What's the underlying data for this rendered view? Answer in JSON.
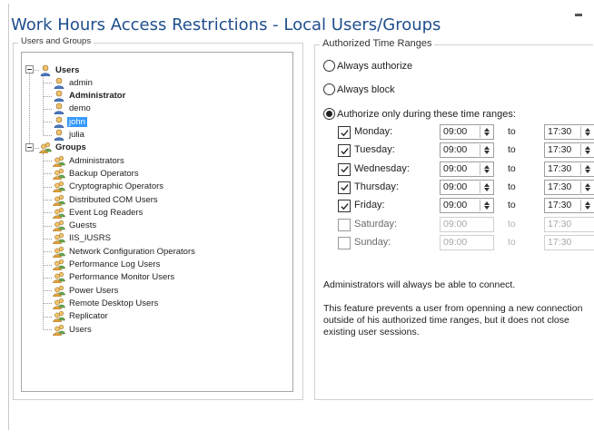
{
  "window": {
    "title": "Work Hours Access Restrictions - Local Users/Groups"
  },
  "users_groups": {
    "legend": "Users and Groups",
    "tree": [
      {
        "label": "Users",
        "kind": "users-root",
        "icon": "single-user-icon",
        "bold": true,
        "expanded": true
      },
      {
        "label": "admin",
        "kind": "user",
        "icon": "single-user-icon"
      },
      {
        "label": "Administrator",
        "kind": "user",
        "icon": "single-user-icon",
        "bold": true
      },
      {
        "label": "demo",
        "kind": "user",
        "icon": "single-user-icon"
      },
      {
        "label": "john",
        "kind": "user",
        "icon": "single-user-icon",
        "selected": true
      },
      {
        "label": "julia",
        "kind": "user",
        "icon": "single-user-icon"
      },
      {
        "label": "Groups",
        "kind": "groups-root",
        "icon": "user-group-icon",
        "bold": true,
        "expanded": true
      },
      {
        "label": "Administrators",
        "kind": "group",
        "icon": "user-group-icon"
      },
      {
        "label": "Backup Operators",
        "kind": "group",
        "icon": "user-group-icon"
      },
      {
        "label": "Cryptographic Operators",
        "kind": "group",
        "icon": "user-group-icon"
      },
      {
        "label": "Distributed COM Users",
        "kind": "group",
        "icon": "user-group-icon"
      },
      {
        "label": "Event Log Readers",
        "kind": "group",
        "icon": "user-group-icon"
      },
      {
        "label": "Guests",
        "kind": "group",
        "icon": "user-group-icon"
      },
      {
        "label": "IIS_IUSRS",
        "kind": "group",
        "icon": "user-group-icon"
      },
      {
        "label": "Network Configuration Operators",
        "kind": "group",
        "icon": "user-group-icon"
      },
      {
        "label": "Performance Log Users",
        "kind": "group",
        "icon": "user-group-icon"
      },
      {
        "label": "Performance Monitor Users",
        "kind": "group",
        "icon": "user-group-icon"
      },
      {
        "label": "Power Users",
        "kind": "group",
        "icon": "user-group-icon"
      },
      {
        "label": "Remote Desktop Users",
        "kind": "group",
        "icon": "user-group-icon"
      },
      {
        "label": "Replicator",
        "kind": "group",
        "icon": "user-group-icon"
      },
      {
        "label": "Users",
        "kind": "group",
        "icon": "user-group-icon"
      }
    ]
  },
  "time_ranges": {
    "legend": "Authorized Time Ranges",
    "options": [
      {
        "label": "Always authorize",
        "selected": false
      },
      {
        "label": "Always block",
        "selected": false
      },
      {
        "label": "Authorize only during these time ranges:",
        "selected": true
      }
    ],
    "days": [
      {
        "label": "Monday:",
        "checked": true,
        "from": "09:00",
        "to_label": "to",
        "to": "17:30"
      },
      {
        "label": "Tuesday:",
        "checked": true,
        "from": "09:00",
        "to_label": "to",
        "to": "17:30"
      },
      {
        "label": "Wednesday:",
        "checked": true,
        "from": "09:00",
        "to_label": "to",
        "to": "17:30"
      },
      {
        "label": "Thursday:",
        "checked": true,
        "from": "09:00",
        "to_label": "to",
        "to": "17:30"
      },
      {
        "label": "Friday:",
        "checked": true,
        "from": "09:00",
        "to_label": "to",
        "to": "17:30"
      },
      {
        "label": "Saturday:",
        "checked": false,
        "from": "09:00",
        "to_label": "to",
        "to": "17:30"
      },
      {
        "label": "Sunday:",
        "checked": false,
        "from": "09:00",
        "to_label": "to",
        "to": "17:30"
      }
    ],
    "admin_note": "Administrators will always be able to connect.",
    "feature_note": "This feature prevents a user from openning a new connection outside of his authorized time ranges, but it does not close existing user sessions."
  },
  "colors": {
    "title": "#1f4e8c",
    "selection": "#3399ff",
    "disabled_text": "#a8a8a8"
  }
}
